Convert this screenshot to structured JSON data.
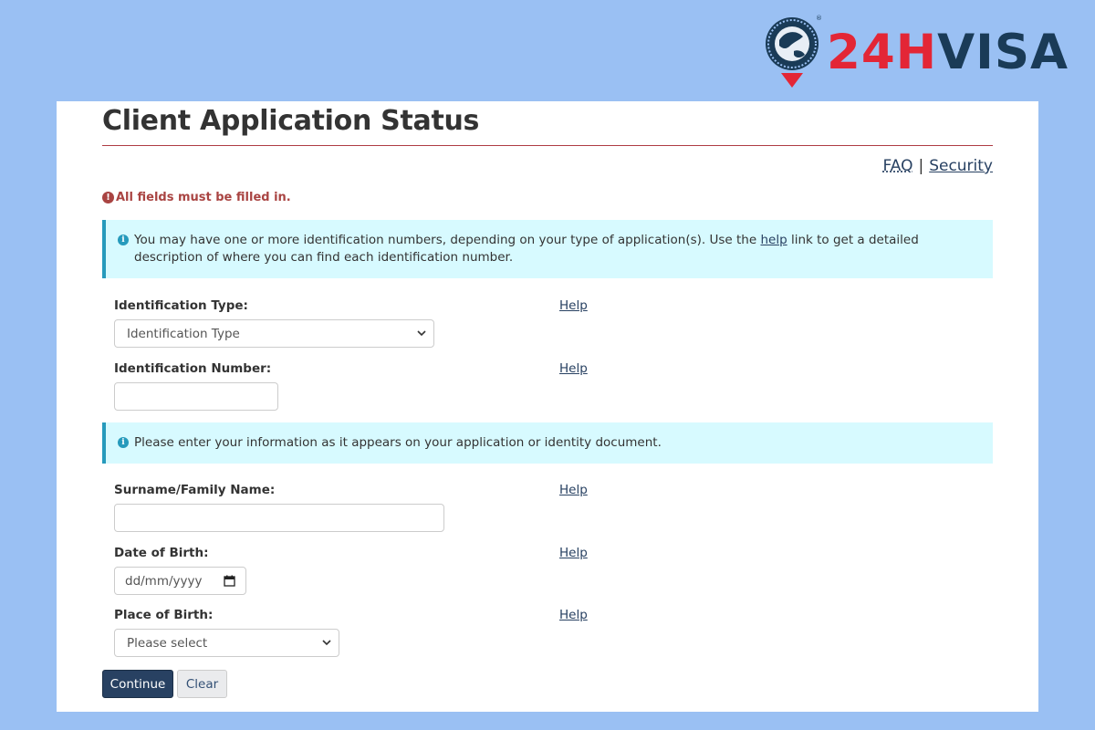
{
  "logo": {
    "prefix": "24H",
    "suffix": "VISA",
    "registered": "®"
  },
  "page": {
    "title": "Client Application Status",
    "faq_label": "FAQ",
    "separator": "|",
    "security_label": "Security",
    "error_message": "All fields must be filled in.",
    "info1": {
      "before_link": "You may have one or more identification numbers, depending on your type of application(s). Use the ",
      "link": "help",
      "after_link": " link to get a detailed description of where you can find each identification number."
    },
    "info2": "Please enter your information as it appears on your application or identity document.",
    "help_label": "Help"
  },
  "form": {
    "identification_type": {
      "label": "Identification Type:",
      "selected": "Identification Type"
    },
    "identification_number": {
      "label": "Identification Number:",
      "value": ""
    },
    "surname": {
      "label": "Surname/Family Name:",
      "value": ""
    },
    "date_of_birth": {
      "label": "Date of Birth:",
      "placeholder": "dd/mm/yyyy"
    },
    "place_of_birth": {
      "label": "Place of Birth:",
      "selected": "Please select"
    }
  },
  "buttons": {
    "continue": "Continue",
    "clear": "Clear"
  },
  "colors": {
    "background": "#9ac0f3",
    "title_rule": "#af3c43",
    "error": "#a94442",
    "info_bg": "#d7faff",
    "info_border": "#269abc",
    "primary_button": "#284162",
    "logo_red": "#e32636",
    "logo_navy": "#1a3b57"
  }
}
